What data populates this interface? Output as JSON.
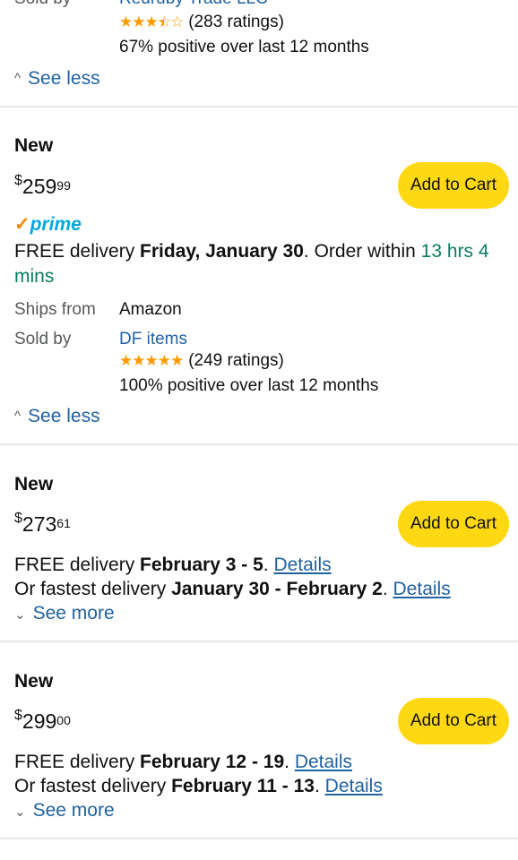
{
  "top_partial": {
    "sold_by_label": "Sold by",
    "seller_name": "Redruby Trade LLC",
    "ratings": "(283 ratings)",
    "stars_rating": 3.5,
    "positive": "67% positive over last 12 months",
    "see_less": "See less"
  },
  "offers": [
    {
      "condition": "New",
      "price_currency": "$",
      "price_whole": "259",
      "price_fraction": "99",
      "add_to_cart": "Add to Cart",
      "prime": "prime",
      "delivery_prefix": "FREE delivery ",
      "delivery_date": "Friday, January 30",
      "delivery_mid": ". Order within ",
      "order_within": "13 hrs 4 mins",
      "ships_from_label": "Ships from",
      "ships_from_value": "Amazon",
      "sold_by_label": "Sold by",
      "seller_name": "DF items",
      "stars_rating": 5,
      "ratings": "(249 ratings)",
      "positive": "100% positive over last 12 months",
      "toggle": "See less"
    },
    {
      "condition": "New",
      "price_currency": "$",
      "price_whole": "273",
      "price_fraction": "61",
      "add_to_cart": "Add to Cart",
      "delivery_prefix": "FREE delivery ",
      "delivery_date": "February 3 - 5",
      "delivery_suffix": ". ",
      "details": "Details",
      "fastest_prefix": "Or fastest delivery ",
      "fastest_date": "January 30 - February 2",
      "fastest_suffix": ". ",
      "fastest_details": "Details",
      "toggle": "See more"
    },
    {
      "condition": "New",
      "price_currency": "$",
      "price_whole": "299",
      "price_fraction": "00",
      "add_to_cart": "Add to Cart",
      "delivery_prefix": "FREE delivery ",
      "delivery_date": "February 12 - 19",
      "delivery_suffix": ". ",
      "details": "Details",
      "fastest_prefix": "Or fastest delivery ",
      "fastest_date": "February 11 - 13",
      "fastest_suffix": ". ",
      "fastest_details": "Details",
      "toggle": "See more"
    }
  ],
  "colors": {
    "button": "#ffd814",
    "link": "#2162a1",
    "green": "#067d62",
    "star": "#ff9900",
    "divider": "#e3e6e6"
  }
}
